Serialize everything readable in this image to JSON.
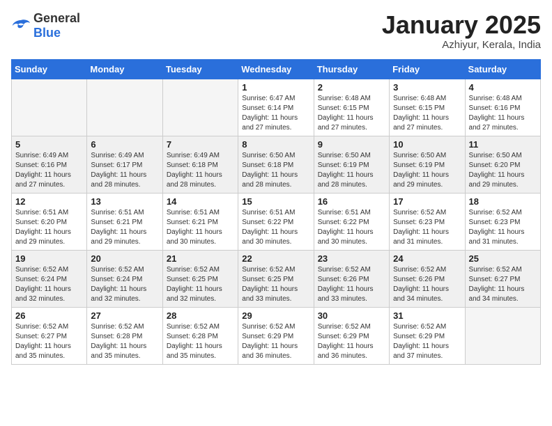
{
  "logo": {
    "general": "General",
    "blue": "Blue"
  },
  "header": {
    "month": "January 2025",
    "location": "Azhiyur, Kerala, India"
  },
  "weekdays": [
    "Sunday",
    "Monday",
    "Tuesday",
    "Wednesday",
    "Thursday",
    "Friday",
    "Saturday"
  ],
  "weeks": [
    [
      {
        "day": "",
        "empty": true
      },
      {
        "day": "",
        "empty": true
      },
      {
        "day": "",
        "empty": true
      },
      {
        "day": "1",
        "sunrise": "6:47 AM",
        "sunset": "6:14 PM",
        "daylight": "11 hours and 27 minutes."
      },
      {
        "day": "2",
        "sunrise": "6:48 AM",
        "sunset": "6:15 PM",
        "daylight": "11 hours and 27 minutes."
      },
      {
        "day": "3",
        "sunrise": "6:48 AM",
        "sunset": "6:15 PM",
        "daylight": "11 hours and 27 minutes."
      },
      {
        "day": "4",
        "sunrise": "6:48 AM",
        "sunset": "6:16 PM",
        "daylight": "11 hours and 27 minutes."
      }
    ],
    [
      {
        "day": "5",
        "sunrise": "6:49 AM",
        "sunset": "6:16 PM",
        "daylight": "11 hours and 27 minutes."
      },
      {
        "day": "6",
        "sunrise": "6:49 AM",
        "sunset": "6:17 PM",
        "daylight": "11 hours and 28 minutes."
      },
      {
        "day": "7",
        "sunrise": "6:49 AM",
        "sunset": "6:18 PM",
        "daylight": "11 hours and 28 minutes."
      },
      {
        "day": "8",
        "sunrise": "6:50 AM",
        "sunset": "6:18 PM",
        "daylight": "11 hours and 28 minutes."
      },
      {
        "day": "9",
        "sunrise": "6:50 AM",
        "sunset": "6:19 PM",
        "daylight": "11 hours and 28 minutes."
      },
      {
        "day": "10",
        "sunrise": "6:50 AM",
        "sunset": "6:19 PM",
        "daylight": "11 hours and 29 minutes."
      },
      {
        "day": "11",
        "sunrise": "6:50 AM",
        "sunset": "6:20 PM",
        "daylight": "11 hours and 29 minutes."
      }
    ],
    [
      {
        "day": "12",
        "sunrise": "6:51 AM",
        "sunset": "6:20 PM",
        "daylight": "11 hours and 29 minutes."
      },
      {
        "day": "13",
        "sunrise": "6:51 AM",
        "sunset": "6:21 PM",
        "daylight": "11 hours and 29 minutes."
      },
      {
        "day": "14",
        "sunrise": "6:51 AM",
        "sunset": "6:21 PM",
        "daylight": "11 hours and 30 minutes."
      },
      {
        "day": "15",
        "sunrise": "6:51 AM",
        "sunset": "6:22 PM",
        "daylight": "11 hours and 30 minutes."
      },
      {
        "day": "16",
        "sunrise": "6:51 AM",
        "sunset": "6:22 PM",
        "daylight": "11 hours and 30 minutes."
      },
      {
        "day": "17",
        "sunrise": "6:52 AM",
        "sunset": "6:23 PM",
        "daylight": "11 hours and 31 minutes."
      },
      {
        "day": "18",
        "sunrise": "6:52 AM",
        "sunset": "6:23 PM",
        "daylight": "11 hours and 31 minutes."
      }
    ],
    [
      {
        "day": "19",
        "sunrise": "6:52 AM",
        "sunset": "6:24 PM",
        "daylight": "11 hours and 32 minutes."
      },
      {
        "day": "20",
        "sunrise": "6:52 AM",
        "sunset": "6:24 PM",
        "daylight": "11 hours and 32 minutes."
      },
      {
        "day": "21",
        "sunrise": "6:52 AM",
        "sunset": "6:25 PM",
        "daylight": "11 hours and 32 minutes."
      },
      {
        "day": "22",
        "sunrise": "6:52 AM",
        "sunset": "6:25 PM",
        "daylight": "11 hours and 33 minutes."
      },
      {
        "day": "23",
        "sunrise": "6:52 AM",
        "sunset": "6:26 PM",
        "daylight": "11 hours and 33 minutes."
      },
      {
        "day": "24",
        "sunrise": "6:52 AM",
        "sunset": "6:26 PM",
        "daylight": "11 hours and 34 minutes."
      },
      {
        "day": "25",
        "sunrise": "6:52 AM",
        "sunset": "6:27 PM",
        "daylight": "11 hours and 34 minutes."
      }
    ],
    [
      {
        "day": "26",
        "sunrise": "6:52 AM",
        "sunset": "6:27 PM",
        "daylight": "11 hours and 35 minutes."
      },
      {
        "day": "27",
        "sunrise": "6:52 AM",
        "sunset": "6:28 PM",
        "daylight": "11 hours and 35 minutes."
      },
      {
        "day": "28",
        "sunrise": "6:52 AM",
        "sunset": "6:28 PM",
        "daylight": "11 hours and 35 minutes."
      },
      {
        "day": "29",
        "sunrise": "6:52 AM",
        "sunset": "6:29 PM",
        "daylight": "11 hours and 36 minutes."
      },
      {
        "day": "30",
        "sunrise": "6:52 AM",
        "sunset": "6:29 PM",
        "daylight": "11 hours and 36 minutes."
      },
      {
        "day": "31",
        "sunrise": "6:52 AM",
        "sunset": "6:29 PM",
        "daylight": "11 hours and 37 minutes."
      },
      {
        "day": "",
        "empty": true
      }
    ]
  ],
  "cell_labels": {
    "sunrise": "Sunrise:",
    "sunset": "Sunset:",
    "daylight": "Daylight:"
  }
}
